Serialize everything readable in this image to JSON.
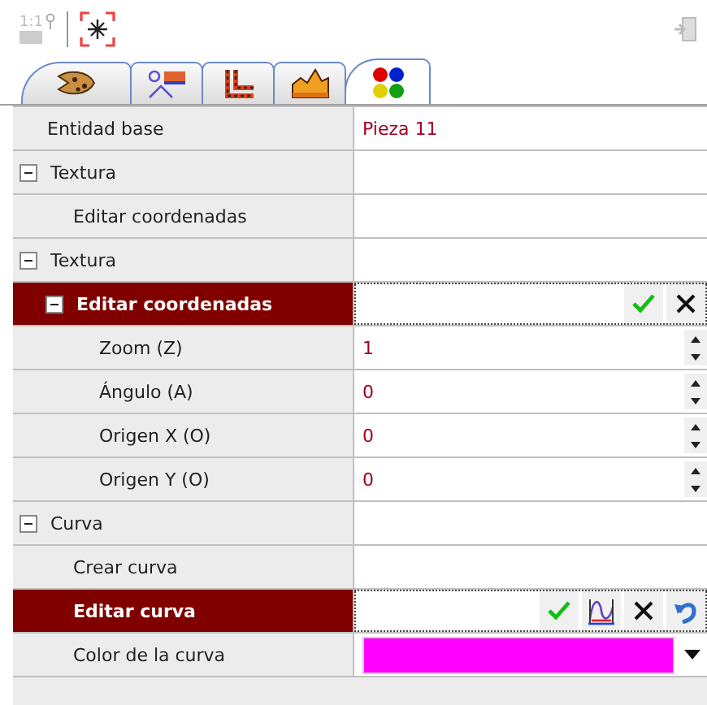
{
  "toolbar": {
    "scale_label": "1:1"
  },
  "tabs": [
    {
      "selected": false
    },
    {
      "selected": false
    },
    {
      "selected": false
    },
    {
      "selected": false
    },
    {
      "selected": true
    }
  ],
  "rows": [
    {
      "label": "Entidad base",
      "value": {
        "kind": "text",
        "text": "Pieza 11"
      }
    },
    {
      "label": "Textura",
      "expanded": true,
      "children": [
        {
          "label": "Editar coordenadas"
        }
      ]
    },
    {
      "label": "Textura",
      "expanded": true,
      "children": [
        {
          "label": "Editar coordenadas",
          "selected": true,
          "expanded": true,
          "value": {
            "kind": "edit"
          },
          "children": [
            {
              "label": "Zoom (Z)",
              "value": {
                "kind": "spin",
                "text": "1"
              }
            },
            {
              "label": "Ángulo (A)",
              "value": {
                "kind": "spin",
                "text": "0"
              }
            },
            {
              "label": "Origen X (O)",
              "value": {
                "kind": "spin",
                "text": "0"
              }
            },
            {
              "label": "Origen Y (O)",
              "value": {
                "kind": "spin",
                "text": "0"
              }
            }
          ]
        }
      ]
    },
    {
      "label": "Curva",
      "expanded": true,
      "children": [
        {
          "label": "Crear curva"
        },
        {
          "label": "Editar curva",
          "selected": true,
          "value": {
            "kind": "edit-curve"
          }
        },
        {
          "label": "Color de la curva",
          "value": {
            "kind": "color",
            "color": "#ff00ff"
          }
        }
      ]
    }
  ]
}
